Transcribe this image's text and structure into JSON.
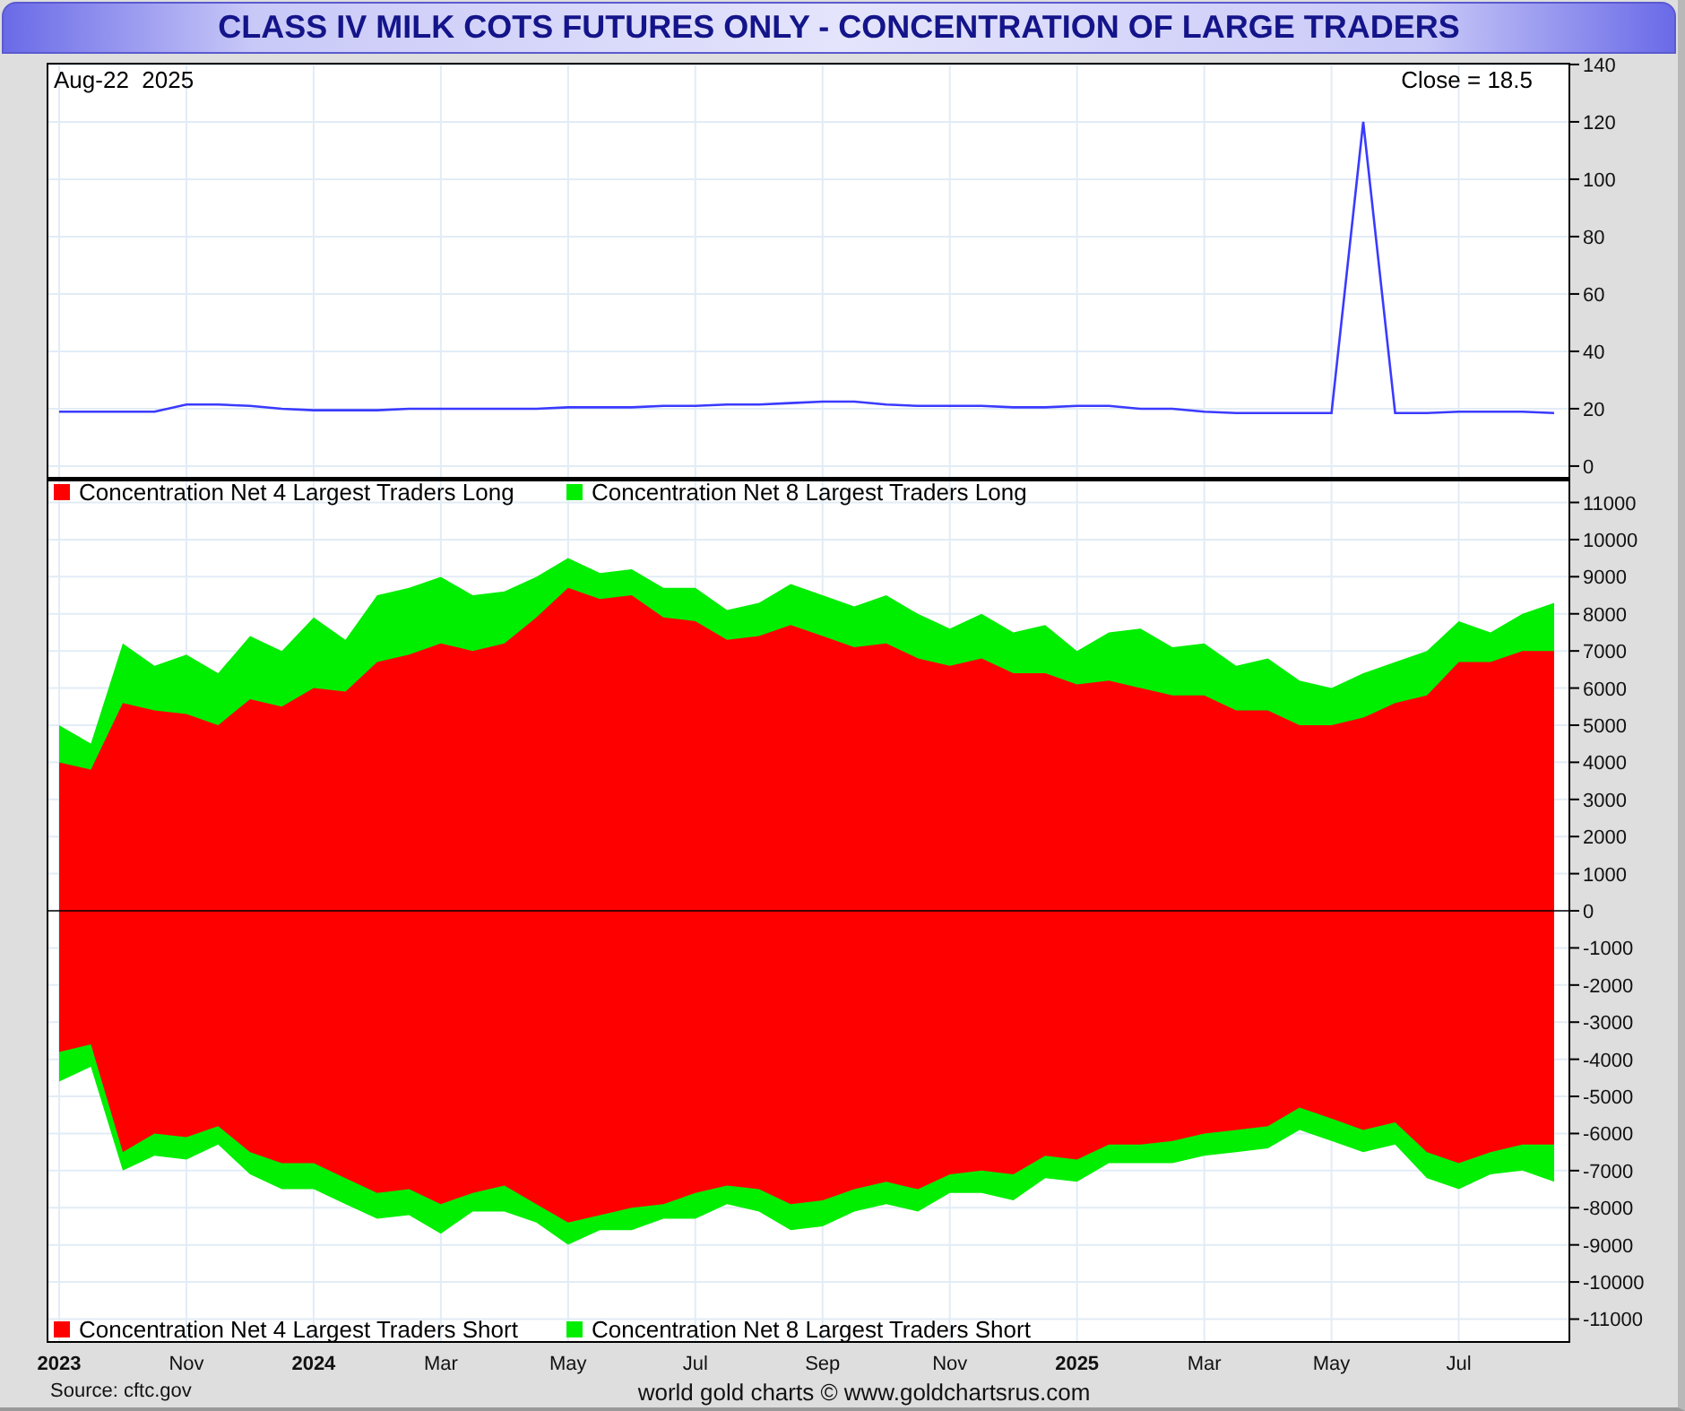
{
  "title": "CLASS IV MILK COTS FUTURES ONLY - CONCENTRATION OF LARGE TRADERS",
  "price_panel": {
    "date": "Aug-22  2025",
    "close": "Close = 18.5",
    "chart_data": {
      "type": "line",
      "series": [
        {
          "color": "#3a3aff",
          "values": [
            19,
            19,
            19,
            19,
            21.5,
            21.5,
            21,
            20,
            19.5,
            19.5,
            19.5,
            20,
            20,
            20,
            20,
            20,
            20.5,
            20.5,
            20.5,
            21,
            21,
            21.5,
            21.5,
            22,
            22.5,
            22.5,
            21.5,
            21,
            21,
            21,
            20.5,
            20.5,
            21,
            21,
            20,
            20,
            19,
            18.5,
            18.5,
            18.5,
            18.5,
            120,
            18.5,
            18.5,
            19,
            19,
            19,
            18.5
          ]
        }
      ],
      "grid": true,
      "ylim": [
        -4.4,
        140.6
      ],
      "yticks": [
        0,
        20,
        40,
        60,
        80,
        100,
        120,
        140
      ]
    }
  },
  "concentration_panel": {
    "chart_data": {
      "type": "area",
      "grid": true,
      "legend": "left",
      "categories": [
        "2023",
        null,
        null,
        null,
        "Nov",
        null,
        null,
        null,
        "2024",
        null,
        null,
        null,
        "Mar",
        null,
        null,
        null,
        "May",
        null,
        null,
        null,
        "Jul",
        null,
        null,
        null,
        "Sep",
        null,
        null,
        null,
        "Nov",
        null,
        null,
        null,
        "2025",
        null,
        null,
        null,
        "Mar",
        null,
        null,
        null,
        "May",
        null,
        null,
        null,
        "Jul",
        null,
        null,
        null
      ],
      "series": [
        {
          "name": "Concentration Net 4 Largest Traders Long",
          "color": "#ff0000",
          "values": [
            4000,
            3800,
            5600,
            5400,
            5300,
            5000,
            5700,
            5500,
            6000,
            5900,
            6700,
            6900,
            7200,
            7000,
            7200,
            7900,
            8700,
            8400,
            8500,
            7900,
            7800,
            7300,
            7400,
            7700,
            7400,
            7100,
            7200,
            6800,
            6600,
            6800,
            6400,
            6400,
            6100,
            6200,
            6000,
            5800,
            5800,
            5400,
            5400,
            5000,
            5000,
            5200,
            5600,
            5800,
            6700,
            6700,
            7000,
            7000
          ]
        },
        {
          "name": "Concentration Net 8 Largest Traders Long",
          "color": "#00ee00",
          "values": [
            5000,
            4500,
            7200,
            6600,
            6900,
            6400,
            7400,
            7000,
            7900,
            7300,
            8500,
            8700,
            9000,
            8500,
            8600,
            9000,
            9500,
            9100,
            9200,
            8700,
            8700,
            8100,
            8300,
            8800,
            8500,
            8200,
            8500,
            8000,
            7600,
            8000,
            7500,
            7700,
            7000,
            7500,
            7600,
            7100,
            7200,
            6600,
            6800,
            6200,
            6000,
            6400,
            6700,
            7000,
            7800,
            7500,
            8000,
            8300
          ]
        },
        {
          "name": "Concentration Net 4 Largest Traders Short",
          "color": "#ff0000",
          "values": [
            -3800,
            -3600,
            -6500,
            -6000,
            -6100,
            -5800,
            -6500,
            -6800,
            -6800,
            -7200,
            -7600,
            -7500,
            -7900,
            -7600,
            -7400,
            -7900,
            -8400,
            -8200,
            -8000,
            -7900,
            -7600,
            -7400,
            -7500,
            -7900,
            -7800,
            -7500,
            -7300,
            -7500,
            -7100,
            -7000,
            -7100,
            -6600,
            -6700,
            -6300,
            -6300,
            -6200,
            -6000,
            -5900,
            -5800,
            -5300,
            -5600,
            -5900,
            -5700,
            -6500,
            -6800,
            -6500,
            -6300,
            -6300
          ]
        },
        {
          "name": "Concentration Net 8 Largest Traders Short",
          "color": "#00ee00",
          "values": [
            -4600,
            -4200,
            -7000,
            -6600,
            -6700,
            -6300,
            -7100,
            -7500,
            -7500,
            -7900,
            -8300,
            -8200,
            -8700,
            -8100,
            -8100,
            -8400,
            -9000,
            -8600,
            -8600,
            -8300,
            -8300,
            -7900,
            -8100,
            -8600,
            -8500,
            -8100,
            -7900,
            -8100,
            -7600,
            -7600,
            -7800,
            -7200,
            -7300,
            -6800,
            -6800,
            -6800,
            -6600,
            -6500,
            -6400,
            -5900,
            -6200,
            -6500,
            -6300,
            -7200,
            -7500,
            -7100,
            -7000,
            -7300
          ]
        }
      ],
      "ylim": [
        -11640,
        11640
      ],
      "yticks": [
        -11000,
        -10000,
        -9000,
        -8000,
        -7000,
        -6000,
        -5000,
        -4000,
        -3000,
        -2000,
        -1000,
        0,
        1000,
        2000,
        3000,
        4000,
        5000,
        6000,
        7000,
        8000,
        9000,
        10000,
        11000
      ]
    }
  },
  "footer": {
    "source": "Source: cftc.gov",
    "credit": "world gold charts © www.goldchartsrus.com"
  }
}
